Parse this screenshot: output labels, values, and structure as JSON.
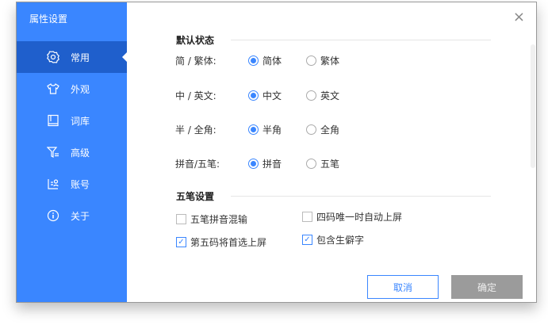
{
  "window": {
    "title": "属性设置",
    "close_icon": "×"
  },
  "sidebar": {
    "items": [
      {
        "label": "常用",
        "icon": "gear-icon"
      },
      {
        "label": "外观",
        "icon": "shirt-icon"
      },
      {
        "label": "词库",
        "icon": "book-icon"
      },
      {
        "label": "高级",
        "icon": "filter-icon"
      },
      {
        "label": "账号",
        "icon": "account-icon"
      },
      {
        "label": "关于",
        "icon": "info-icon"
      }
    ]
  },
  "default_state": {
    "heading": "默认状态",
    "rows": [
      {
        "label": "简 / 繁体:",
        "options": [
          "简体",
          "繁体"
        ],
        "selected": 0
      },
      {
        "label": "中 / 英文:",
        "options": [
          "中文",
          "英文"
        ],
        "selected": 0
      },
      {
        "label": "半 / 全角:",
        "options": [
          "半角",
          "全角"
        ],
        "selected": 0
      },
      {
        "label": "拼音/五笔:",
        "options": [
          "拼音",
          "五笔"
        ],
        "selected": 0
      }
    ]
  },
  "wubi": {
    "heading": "五笔设置",
    "options": [
      {
        "label": "五笔拼音混输",
        "checked": false
      },
      {
        "label": "四码唯一时自动上屏",
        "checked": false
      },
      {
        "label": "第五码将首选上屏",
        "checked": true
      },
      {
        "label": "包含生僻字",
        "checked": true
      }
    ]
  },
  "buttons": {
    "cancel": "取消",
    "ok": "确定"
  }
}
